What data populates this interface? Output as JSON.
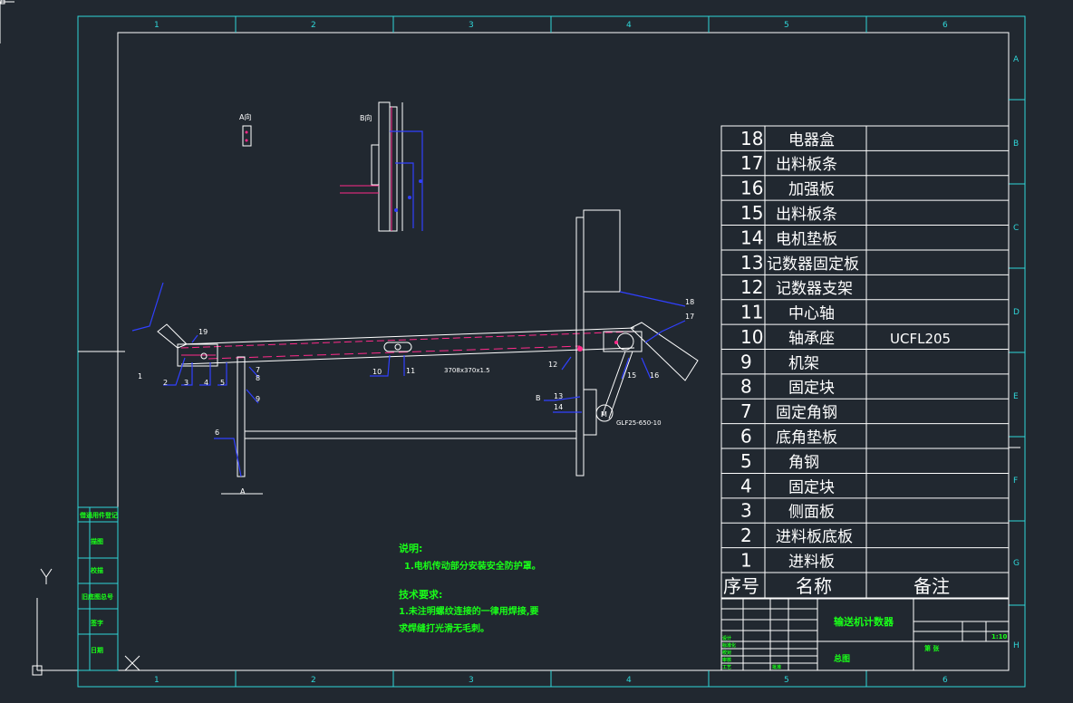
{
  "frame": {
    "columns": [
      "1",
      "2",
      "3",
      "4",
      "5",
      "6"
    ],
    "rows": [
      "A",
      "B",
      "C",
      "D",
      "E",
      "F",
      "G",
      "H"
    ]
  },
  "view_labels": {
    "a_view": "A向",
    "b_view": "B向",
    "section_a": "A",
    "section_b": "B"
  },
  "callouts": [
    "1",
    "2",
    "3",
    "4",
    "5",
    "6",
    "7",
    "8",
    "9",
    "10",
    "11",
    "12",
    "13",
    "14",
    "15",
    "16",
    "17",
    "18",
    "19"
  ],
  "drawing_notes": {
    "chain_spec": "3708x370x1.5",
    "motor_symbol": "M",
    "motor_spec": "GLF25-650-10"
  },
  "parts_list": [
    {
      "no": "18",
      "name": "电器盒",
      "remark": ""
    },
    {
      "no": "17",
      "name": "出料板条",
      "remark": ""
    },
    {
      "no": "16",
      "name": "加强板",
      "remark": ""
    },
    {
      "no": "15",
      "name": "出料板条",
      "remark": ""
    },
    {
      "no": "14",
      "name": "电机垫板",
      "remark": ""
    },
    {
      "no": "13",
      "name": "记数器固定板",
      "remark": ""
    },
    {
      "no": "12",
      "name": "记数器支架",
      "remark": ""
    },
    {
      "no": "11",
      "name": "中心轴",
      "remark": ""
    },
    {
      "no": "10",
      "name": "轴承座",
      "remark": "UCFL205"
    },
    {
      "no": "9",
      "name": "机架",
      "remark": ""
    },
    {
      "no": "8",
      "name": "固定块",
      "remark": ""
    },
    {
      "no": "7",
      "name": "固定角钢",
      "remark": ""
    },
    {
      "no": "6",
      "name": "底角垫板",
      "remark": ""
    },
    {
      "no": "5",
      "name": "角钢",
      "remark": ""
    },
    {
      "no": "4",
      "name": "固定块",
      "remark": ""
    },
    {
      "no": "3",
      "name": "侧面板",
      "remark": ""
    },
    {
      "no": "2",
      "name": "进料板底板",
      "remark": ""
    },
    {
      "no": "1",
      "name": "进料板",
      "remark": ""
    }
  ],
  "parts_header": {
    "no": "序号",
    "name": "名称",
    "remark": "备注"
  },
  "notes": {
    "title": "说明:",
    "line1": "1.电机传动部分安装安全防护罩。",
    "tech_title": "技术要求:",
    "tech_line1": "1.未注明螺纹连接的一律用焊接,要",
    "tech_line2": "求焊缝打光滑无毛刺。"
  },
  "title_block": {
    "drawing_name": "输送机计数器",
    "sub_name": "总图",
    "scale": "1:10",
    "sheet": "第 张",
    "small_cells": [
      "设计",
      "标准化",
      "校对",
      "审核",
      "工艺",
      "批准"
    ]
  },
  "side_stamp": [
    "借通用件登记",
    "描图",
    "校描",
    "旧底图总号",
    "签字",
    "日期"
  ]
}
